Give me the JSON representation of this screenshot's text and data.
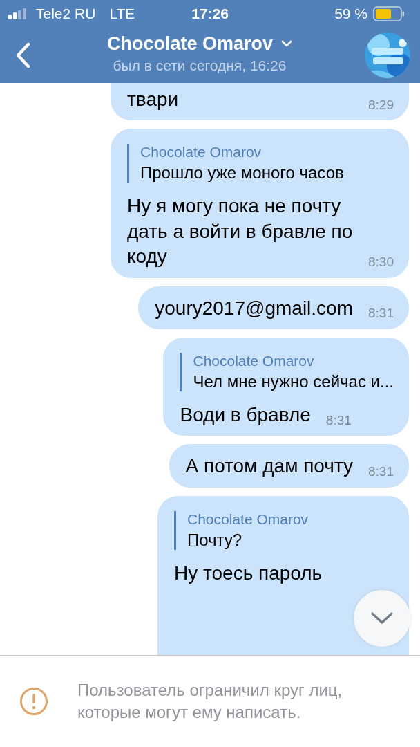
{
  "status_bar": {
    "carrier": "Tele2 RU",
    "network": "LTE",
    "time": "17:26",
    "battery": "59 %"
  },
  "header": {
    "title": "Chocolate Omarov",
    "subtitle": "был в сети сегодня, 16:26"
  },
  "messages": [
    {
      "text": "твари",
      "time": "8:29"
    },
    {
      "reply": {
        "author": "Chocolate Omarov",
        "text": "Прошло уже моного часов"
      },
      "text": "Ну я могу пока не почту дать а войти в бравле по коду",
      "time": "8:30"
    },
    {
      "text": "youry2017@gmail.com",
      "time": "8:31"
    },
    {
      "reply": {
        "author": "Chocolate Omarov",
        "text": "Чел мне нужно сейчас и..."
      },
      "text": "Води в бравле",
      "time": "8:31"
    },
    {
      "text": "А потом дам почту",
      "time": "8:31"
    },
    {
      "reply": {
        "author": "Chocolate Omarov",
        "text": "Почту?"
      },
      "text": "Ну тоесь пароль"
    }
  ],
  "notice": {
    "text": "Пользователь ограничил круг лиц, которые могут ему написать."
  }
}
